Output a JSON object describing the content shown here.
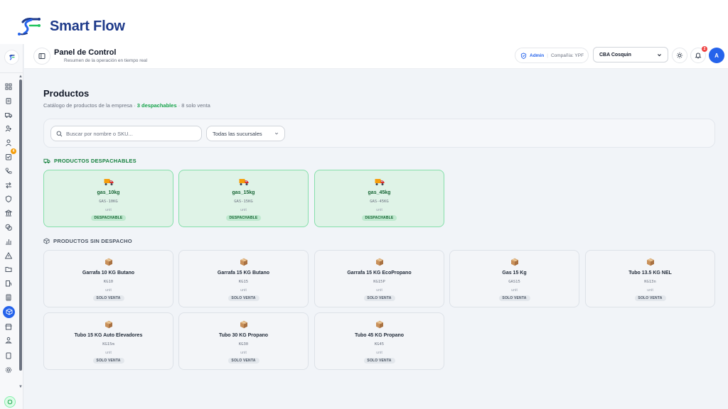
{
  "brand": {
    "name": "Smart Flow"
  },
  "header": {
    "title": "Panel de Control",
    "subtitle": "Resumen de la operación en tiempo real",
    "role": "Admin",
    "company": "Compañía: YPF",
    "branch_selected": "CBA Cosquin",
    "notifications_count": "2",
    "avatar_initial": "A"
  },
  "sidebar": {
    "icons": [
      "dashboard-icon",
      "clipboard-icon",
      "truck-icon",
      "users-icon",
      "user-icon",
      "tasks-icon",
      "phone-icon",
      "transfer-icon",
      "shield-icon",
      "bank-icon",
      "coins-icon",
      "chart-icon",
      "alert-icon",
      "folder-icon",
      "fuel-icon",
      "calculator-icon",
      "box-icon",
      "store-icon",
      "contacts-icon",
      "tablet-icon",
      "gear-icon"
    ],
    "tasks_badge": "4",
    "active": "box-icon"
  },
  "page": {
    "title": "Productos",
    "subtitle_prefix": "Catálogo de productos de la empresa · ",
    "dispatchable_count_text": "3 despachables",
    "subtitle_suffix": " · 8 solo venta"
  },
  "filters": {
    "search_placeholder": "Buscar por nombre o SKU...",
    "branch_filter": "Todas las sucursales"
  },
  "sections": {
    "dispatchable": "PRODUCTOS DESPACHABLES",
    "sale_only": "PRODUCTOS SIN DESPACHO"
  },
  "dispatchable_products": [
    {
      "name": "gas_10kg",
      "sku": "GAS-10KG",
      "unit": "unit",
      "tag": "DESPACHABLE"
    },
    {
      "name": "gas_15kg",
      "sku": "GAS-15KG",
      "unit": "unit",
      "tag": "DESPACHABLE"
    },
    {
      "name": "gas_45kg",
      "sku": "GAS-45KG",
      "unit": "unit",
      "tag": "DESPACHABLE"
    }
  ],
  "sale_products": [
    {
      "name": "Garrafa 10 KG Butano",
      "sku": "KG10",
      "unit": "unit",
      "tag": "SOLO VENTA"
    },
    {
      "name": "Garrafa 15 KG Butano",
      "sku": "KG15",
      "unit": "unit",
      "tag": "SOLO VENTA"
    },
    {
      "name": "Garrafa 15 KG EcoPropano",
      "sku": "KG15P",
      "unit": "unit",
      "tag": "SOLO VENTA"
    },
    {
      "name": "Gas 15 Kg",
      "sku": "GAS15",
      "unit": "unit",
      "tag": "SOLO VENTA"
    },
    {
      "name": "Tubo 13.5 KG NEL",
      "sku": "KG13n",
      "unit": "unit",
      "tag": "SOLO VENTA"
    },
    {
      "name": "Tubo 15 KG Auto Elevadores",
      "sku": "KG15m",
      "unit": "unit",
      "tag": "SOLO VENTA"
    },
    {
      "name": "Tubo 30 KG Propano",
      "sku": "KG30",
      "unit": "unit",
      "tag": "SOLO VENTA"
    },
    {
      "name": "Tubo 45 KG Propano",
      "sku": "KG45",
      "unit": "unit",
      "tag": "SOLO VENTA"
    }
  ],
  "colors": {
    "accent": "#2563eb",
    "dispatch_green": "#16a34a",
    "brand_navy": "#1e3a8a"
  }
}
